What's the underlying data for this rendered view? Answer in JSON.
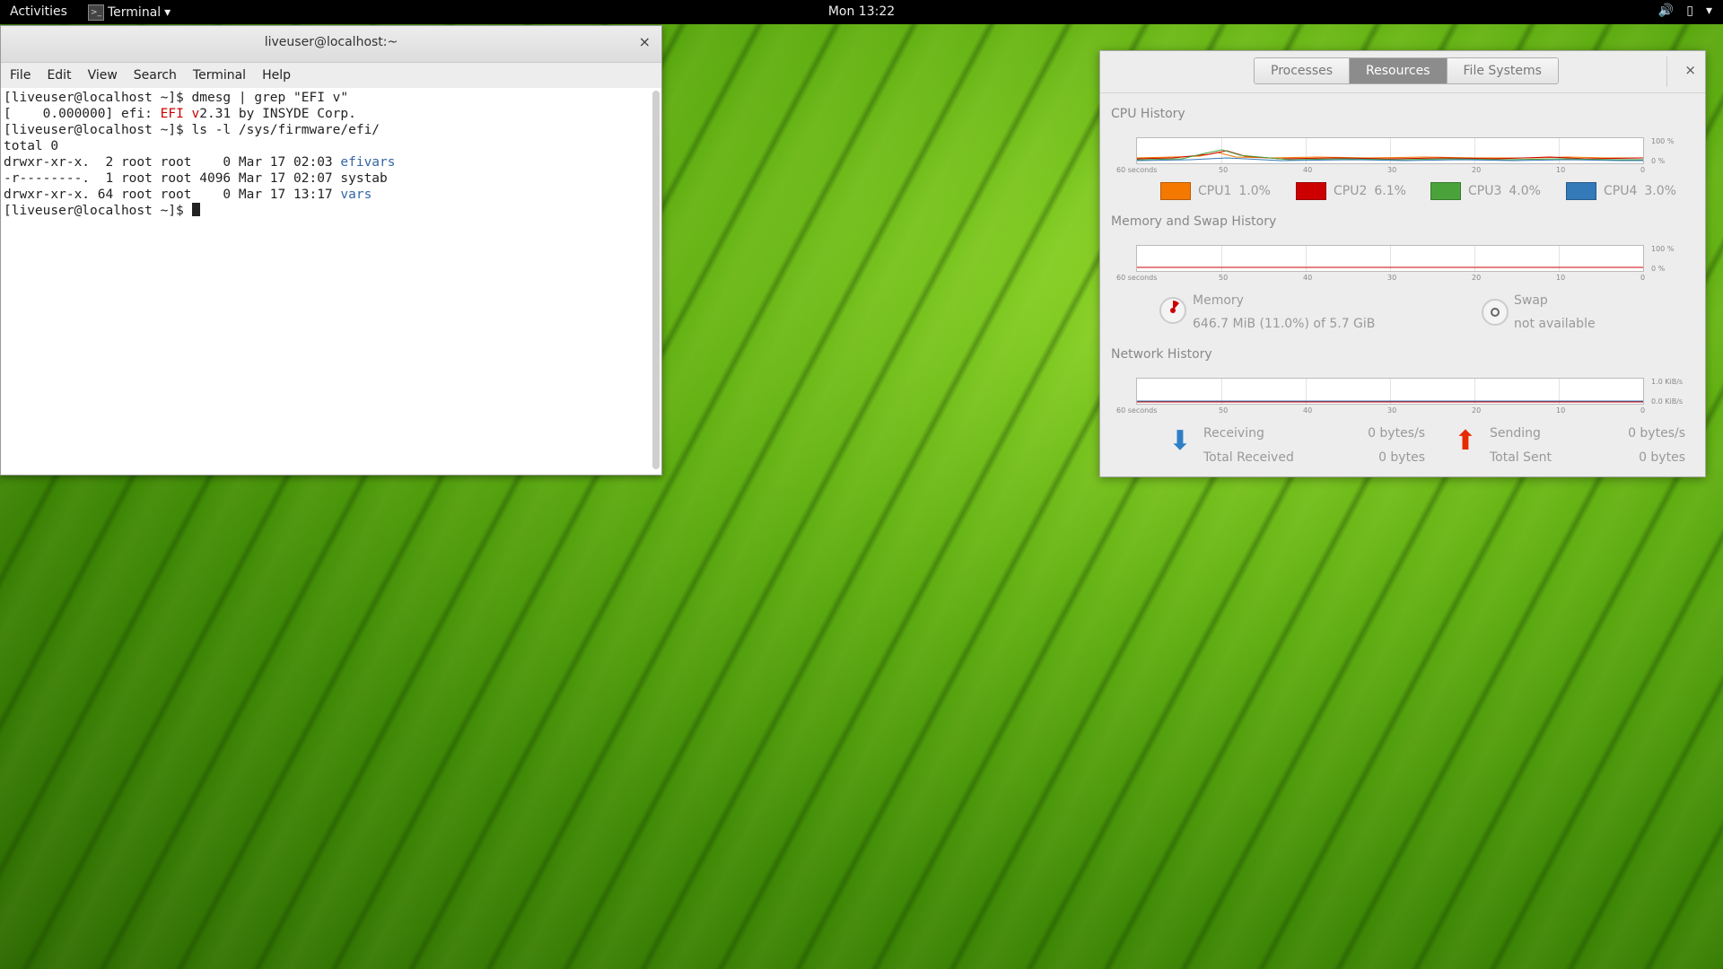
{
  "topbar": {
    "activities": "Activities",
    "app_name": "Terminal",
    "app_menu_arrow": "▾",
    "clock": "Mon 13:22",
    "status_icons": [
      "volume-icon",
      "battery-icon",
      "system-menu-arrow-icon"
    ]
  },
  "terminal": {
    "title": "liveuser@localhost:~",
    "close": "×",
    "menu": [
      "File",
      "Edit",
      "View",
      "Search",
      "Terminal",
      "Help"
    ],
    "lines": {
      "l1": "[liveuser@localhost ~]$ dmesg | grep \"EFI v\"",
      "l2_pre": "[    0.000000] efi: ",
      "l2_efi": "EFI v",
      "l2_post": "2.31 by INSYDE Corp.",
      "l3": "[liveuser@localhost ~]$ ls -l /sys/firmware/efi/",
      "l4": "total 0",
      "l5_pre": "drwxr-xr-x.  2 root root    0 Mar 17 02:03 ",
      "l5_name": "efivars",
      "l6": "-r--------.  1 root root 4096 Mar 17 02:07 systab",
      "l7_pre": "drwxr-xr-x. 64 root root    0 Mar 17 13:17 ",
      "l7_name": "vars",
      "l8": "[liveuser@localhost ~]$ "
    }
  },
  "sysmon": {
    "tabs": [
      "Processes",
      "Resources",
      "File Systems"
    ],
    "active_tab": "Resources",
    "close": "×",
    "cpu": {
      "title": "CPU History",
      "xticks": [
        "60 seconds",
        "50",
        "40",
        "30",
        "20",
        "10",
        "0"
      ],
      "yticks": [
        "100 %",
        "0 %"
      ],
      "legend": [
        {
          "label": "CPU1",
          "value": "1.0%",
          "color": "#f57900"
        },
        {
          "label": "CPU2",
          "value": "6.1%",
          "color": "#cc0000"
        },
        {
          "label": "CPU3",
          "value": "4.0%",
          "color": "#4aa33a"
        },
        {
          "label": "CPU4",
          "value": "3.0%",
          "color": "#3479b8"
        }
      ]
    },
    "memory": {
      "title": "Memory and Swap History",
      "xticks": [
        "60 seconds",
        "50",
        "40",
        "30",
        "20",
        "10",
        "0"
      ],
      "yticks": [
        "100 %",
        "0 %"
      ],
      "mem_label": "Memory",
      "mem_value": "646.7 MiB (11.0%) of 5.7 GiB",
      "swap_label": "Swap",
      "swap_value": "not available"
    },
    "network": {
      "title": "Network History",
      "xticks": [
        "60 seconds",
        "50",
        "40",
        "30",
        "20",
        "10",
        "0"
      ],
      "yticks": [
        "1.0 KiB/s",
        "0.0 KiB/s"
      ],
      "receiving_label": "Receiving",
      "receiving_value": "0 bytes/s",
      "total_received_label": "Total Received",
      "total_received_value": "0 bytes",
      "sending_label": "Sending",
      "sending_value": "0 bytes/s",
      "total_sent_label": "Total Sent",
      "total_sent_value": "0 bytes"
    }
  }
}
